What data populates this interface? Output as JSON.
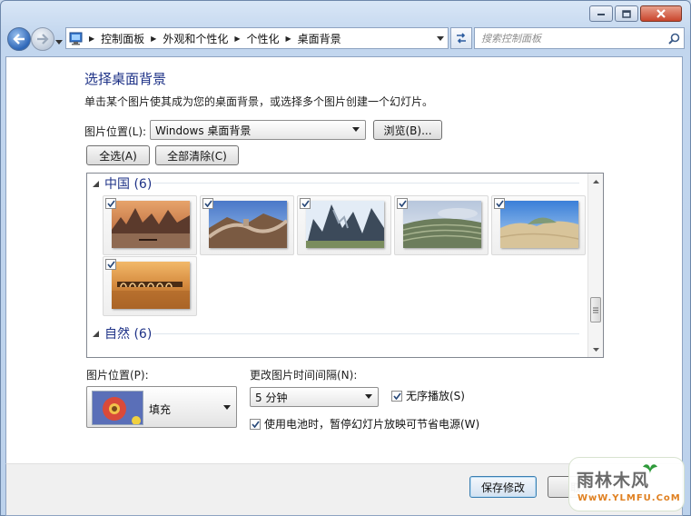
{
  "window": {
    "caption_buttons": [
      {
        "name": "minimize",
        "icon": "minimize-icon"
      },
      {
        "name": "maximize",
        "icon": "maximize-icon"
      },
      {
        "name": "close",
        "icon": "close-icon"
      }
    ]
  },
  "nav": {
    "breadcrumbs": [
      "控制面板",
      "外观和个性化",
      "个性化",
      "桌面背景"
    ],
    "search_placeholder": "搜索控制面板"
  },
  "page": {
    "title": "选择桌面背景",
    "subtitle": "单击某个图片使其成为您的桌面背景，或选择多个图片创建一个幻灯片。",
    "location_label": "图片位置(L):",
    "location_value": "Windows 桌面背景",
    "browse_label": "浏览(B)...",
    "select_all_label": "全选(A)",
    "clear_all_label": "全部清除(C)"
  },
  "gallery": {
    "groups": [
      {
        "title": "中国 (6)",
        "items": [
          {
            "name": "karst-river",
            "checked": true
          },
          {
            "name": "great-wall",
            "checked": true
          },
          {
            "name": "rocky-peaks",
            "checked": true
          },
          {
            "name": "terraced-fields",
            "checked": true
          },
          {
            "name": "sand-dunes",
            "checked": true
          },
          {
            "name": "seventeen-arch-bridge",
            "checked": true
          }
        ]
      },
      {
        "title": "自然 (6)",
        "items": []
      }
    ]
  },
  "options": {
    "position_label": "图片位置(P):",
    "position_value": "填充",
    "interval_label": "更改图片时间间隔(N):",
    "interval_value": "5 分钟",
    "shuffle_label": "无序播放(S)",
    "shuffle_checked": true,
    "battery_label": "使用电池时，暂停幻灯片放映可节省电源(W)",
    "battery_checked": true
  },
  "footer": {
    "save_label": "保存修改",
    "cancel_label": "取消"
  },
  "watermark": {
    "title": "雨林木风",
    "url": "WwW.YLMFU.CoM"
  }
}
